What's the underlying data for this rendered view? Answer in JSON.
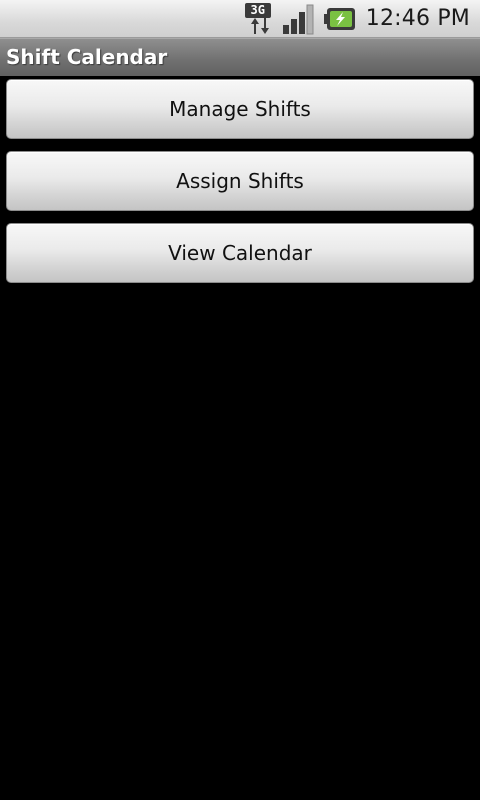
{
  "status_bar": {
    "network_type": "3G",
    "time": "12:46 PM",
    "icons": [
      "3g-data-icon",
      "signal-strength-icon",
      "battery-charging-icon"
    ]
  },
  "app": {
    "title": "Shift Calendar"
  },
  "menu": {
    "manage_shifts": "Manage Shifts",
    "assign_shifts": "Assign Shifts",
    "view_calendar": "View Calendar"
  },
  "colors": {
    "background": "#000000",
    "title_bar": "#6f6f6f",
    "status_bar": "#d9d9d9",
    "battery_accent": "#7ac142"
  }
}
